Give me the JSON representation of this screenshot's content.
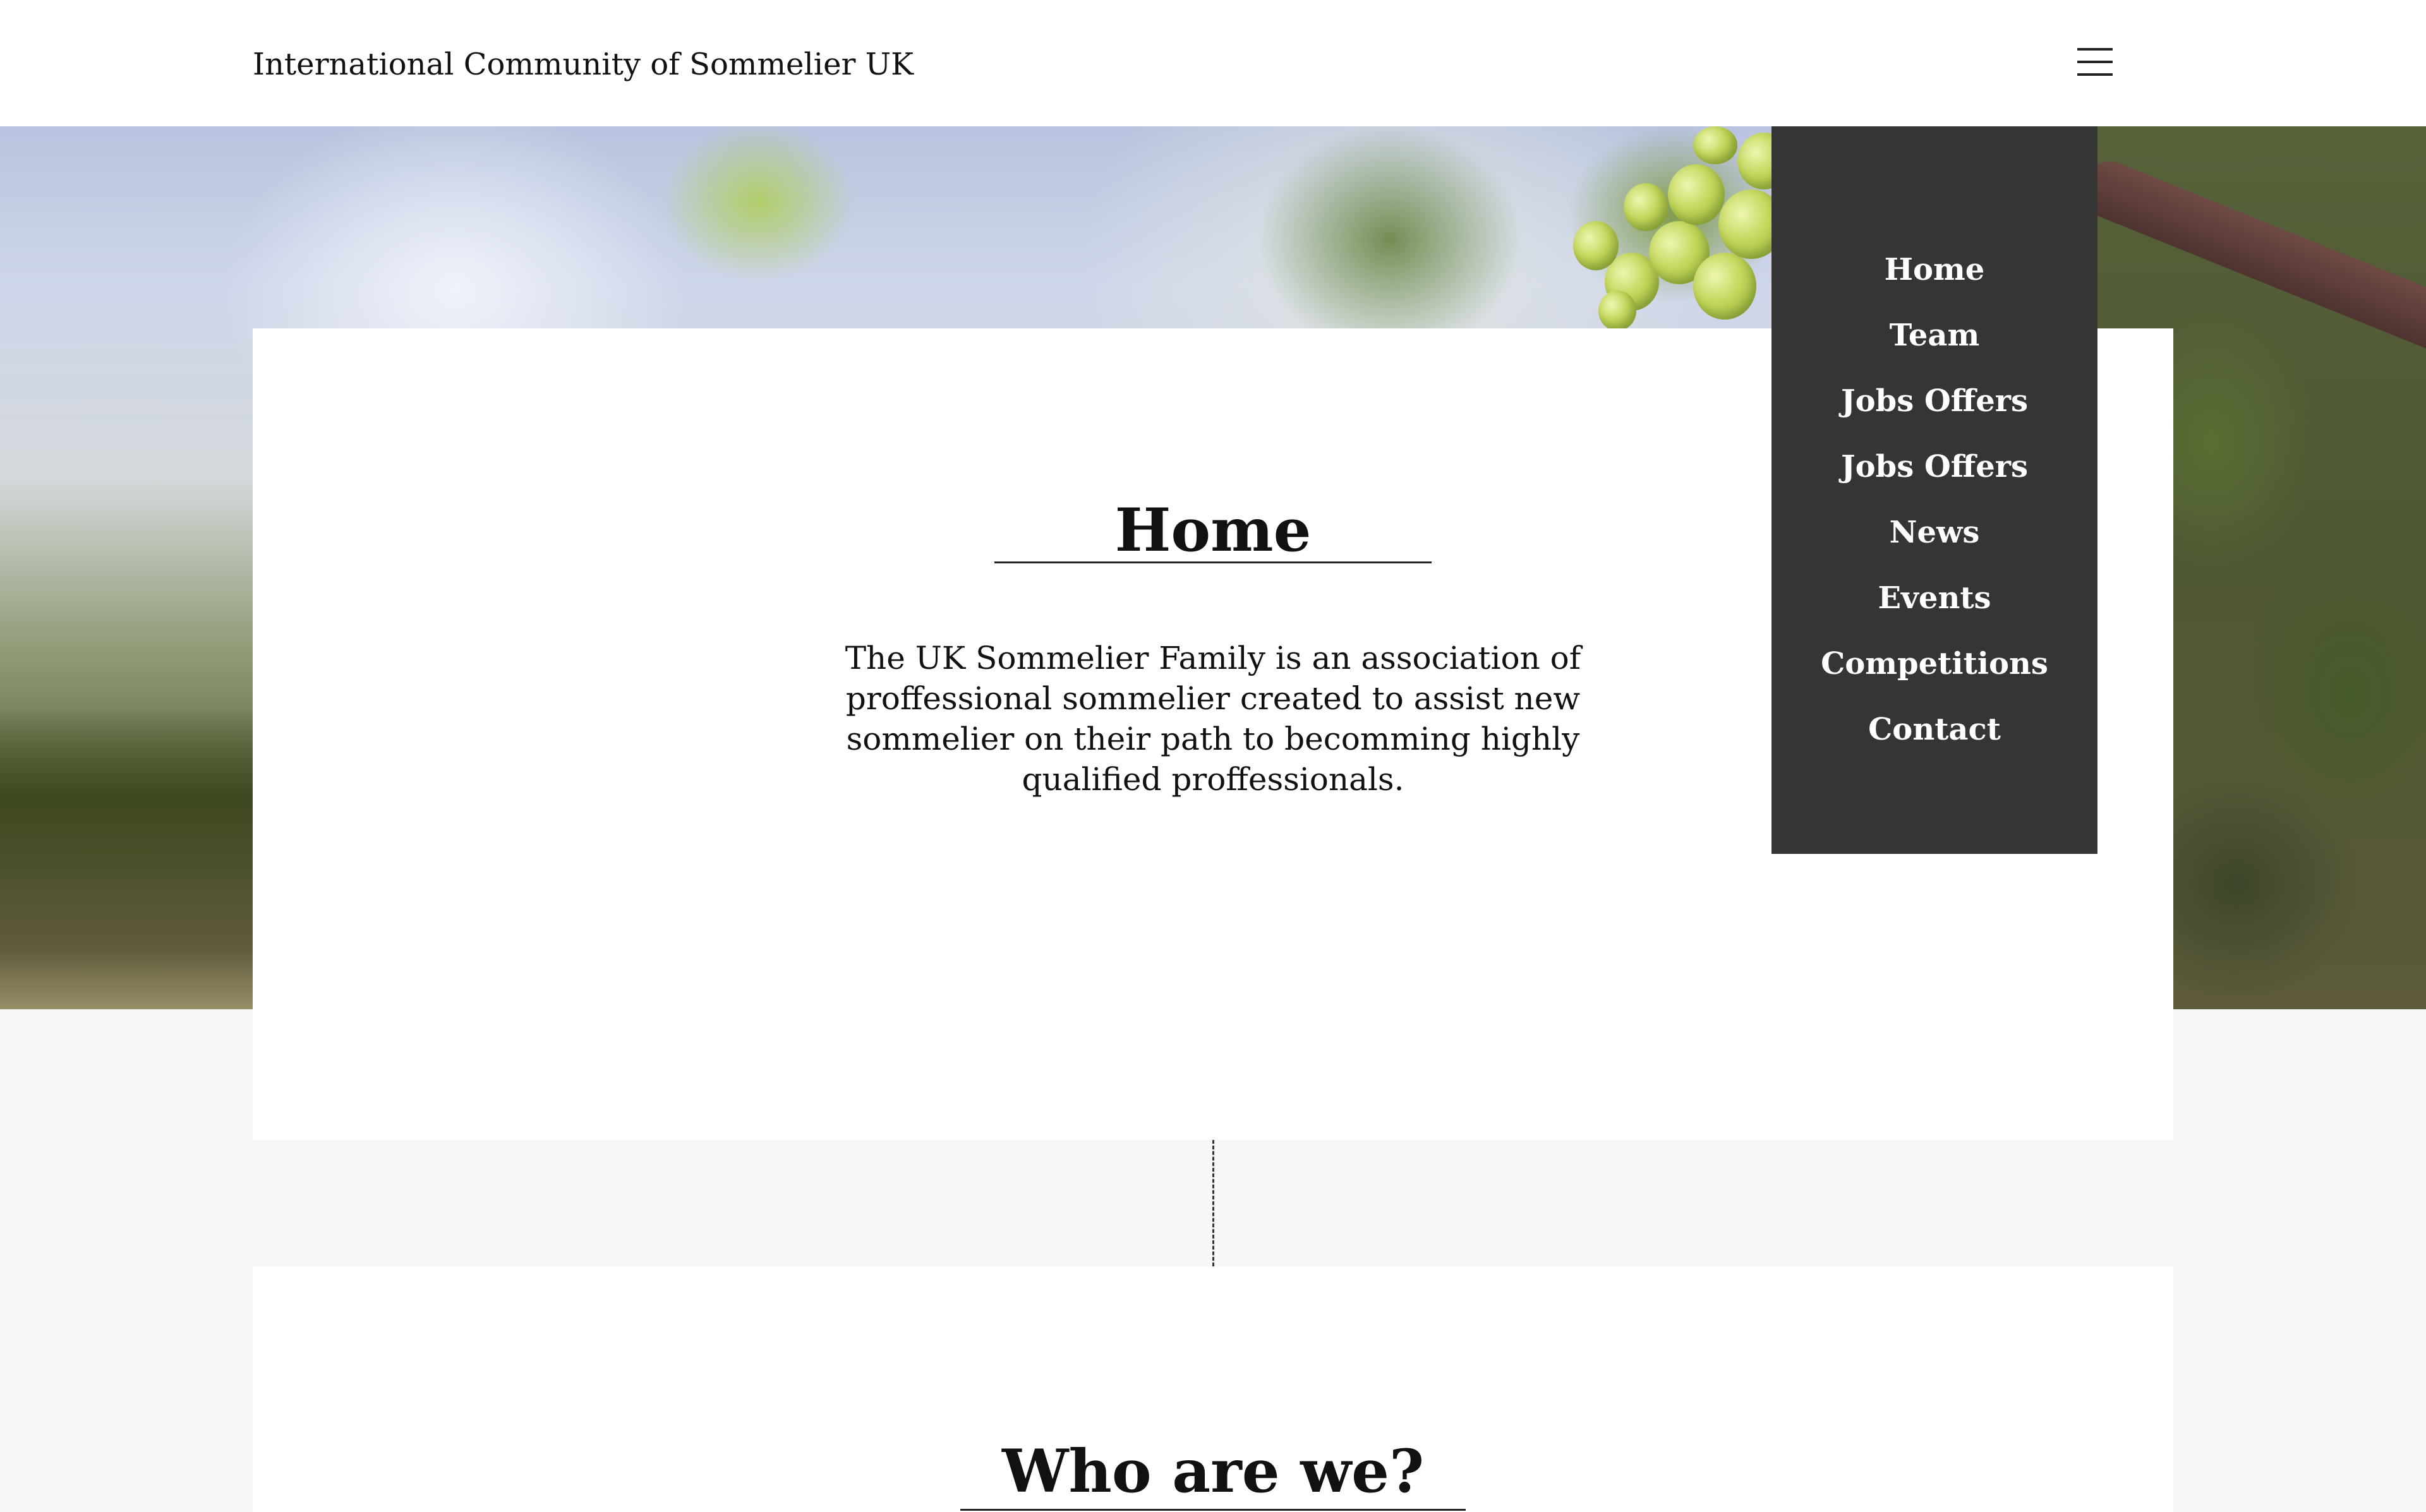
{
  "header": {
    "site_title": "International Community of Sommelier UK",
    "menu_icon": "hamburger-menu-icon"
  },
  "nav": {
    "items": [
      {
        "label": "Home"
      },
      {
        "label": "Team"
      },
      {
        "label": "Jobs Offers"
      },
      {
        "label": "Jobs Offers"
      },
      {
        "label": "News"
      },
      {
        "label": "Events"
      },
      {
        "label": "Competitions"
      },
      {
        "label": "Contact"
      }
    ]
  },
  "home": {
    "title": "Home",
    "text": "The UK Sommelier Family is an association of proffessional sommelier created to assist new sommelier on their path to becomming highly qualified proffessionals."
  },
  "who": {
    "title": "Who are we?"
  },
  "colors": {
    "menu_background": "#353535",
    "page_background": "#f7f7f7",
    "card_background": "#ffffff",
    "text": "#111111"
  }
}
